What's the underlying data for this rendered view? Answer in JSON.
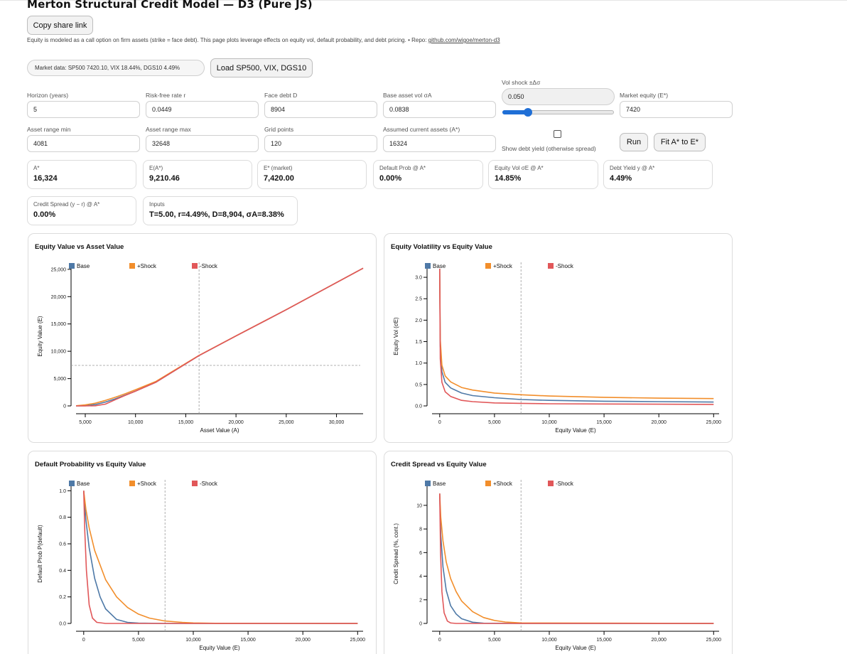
{
  "header": {
    "title": "Merton Structural Credit Model — D3 (Pure JS)",
    "copy_button": "Copy share link",
    "description_prefix": "Equity is modeled as a call option on firm assets (strike = face debt). This page plots leverage effects on equity vol, default probability, and debt pricing.  •  Repo: ",
    "repo_link": "github.com/wigoe/merton-d3"
  },
  "market": {
    "pill": "Market data: SP500 7420.10, VIX 18.44%, DGS10 4.49%",
    "load_button": "Load SP500, VIX, DGS10"
  },
  "inputs": {
    "horizon": {
      "label": "Horizon (years)",
      "value": "5"
    },
    "rate": {
      "label": "Risk-free rate r",
      "value": "0.0449"
    },
    "face_debt": {
      "label": "Face debt D",
      "value": "8904"
    },
    "base_vol": {
      "label": "Base asset vol σA",
      "value": "0.0838"
    },
    "vol_shock": {
      "label": "Vol shock ±Δσ",
      "value": "0.050",
      "slider_fraction": 0.2
    },
    "market_equity": {
      "label": "Market equity (E*)",
      "value": "7420"
    },
    "asset_min": {
      "label": "Asset range min",
      "value": "4081"
    },
    "asset_max": {
      "label": "Asset range max",
      "value": "32648"
    },
    "grid_points": {
      "label": "Grid points",
      "value": "120"
    },
    "current_assets": {
      "label": "Assumed current assets (A*)",
      "value": "16324"
    },
    "show_yield": {
      "label": "Show debt yield (otherwise spread)",
      "checked": false
    },
    "run_button": "Run",
    "fit_button": "Fit A* to E*"
  },
  "results": [
    {
      "label": "A*",
      "value": "16,324"
    },
    {
      "label": "E(A*)",
      "value": "9,210.46"
    },
    {
      "label": "E* (market)",
      "value": "7,420.00"
    },
    {
      "label": "Default Prob @ A*",
      "value": "0.00%"
    },
    {
      "label": "Equity Vol σE @ A*",
      "value": "14.85%"
    },
    {
      "label": "Debt Yield y @ A*",
      "value": "4.49%"
    },
    {
      "label": "Credit Spread (y − r) @ A*",
      "value": "0.00%"
    },
    {
      "label": "Inputs",
      "value": "T=5.00, r=4.49%, D=8,904, σA=8.38%"
    }
  ],
  "colors": {
    "base": "#4e79a7",
    "plus": "#f28e2b",
    "minus": "#e15759"
  },
  "legend": {
    "base": "Base",
    "plus": "+Shock",
    "minus": "-Shock"
  },
  "charts": [
    {
      "title": "Equity Value vs Asset Value",
      "chart_data": {
        "type": "line",
        "title": "Equity Value vs Asset Value",
        "xlabel": "Asset Value (A)",
        "ylabel": "Equity Value (E)",
        "xlim": [
          4081,
          32648
        ],
        "ylim": [
          0,
          25500
        ],
        "xticks": [
          5000,
          10000,
          15000,
          20000,
          25000,
          30000
        ],
        "yticks": [
          0,
          5000,
          10000,
          15000,
          20000,
          25000
        ],
        "x_tick_labels": [
          "5,000",
          "10,000",
          "15,000",
          "20,000",
          "25,000",
          "30,000"
        ],
        "y_tick_labels": [
          "0",
          "5,000",
          "10,000",
          "15,000",
          "20,000",
          "25,000"
        ],
        "vline_x": 16324,
        "hline_y": 7420,
        "grid": false,
        "legend_position": "top",
        "series": [
          {
            "name": "Base",
            "x": [
              4081,
              5000,
              6000,
              7000,
              8000,
              9000,
              10000,
              12000,
              16324,
              20000,
              25000,
              32648
            ],
            "y": [
              0,
              30,
              250,
              700,
              1300,
              2000,
              2700,
              4300,
              9210,
              12800,
              17600,
              25200
            ]
          },
          {
            "name": "+Shock",
            "x": [
              4081,
              5000,
              6000,
              7000,
              8000,
              9000,
              10000,
              12000,
              16324,
              20000,
              25000,
              32648
            ],
            "y": [
              30,
              180,
              500,
              1000,
              1600,
              2250,
              2950,
              4450,
              9250,
              12820,
              17620,
              25200
            ]
          },
          {
            "name": "-Shock",
            "x": [
              4081,
              5000,
              6000,
              7000,
              8000,
              9000,
              10000,
              12000,
              16324,
              20000,
              25000,
              32648
            ],
            "y": [
              0,
              0,
              30,
              330,
              1150,
              1950,
              2700,
              4300,
              9210,
              12800,
              17600,
              25200
            ]
          }
        ]
      }
    },
    {
      "title": "Equity Volatility vs Equity Value",
      "chart_data": {
        "type": "line",
        "title": "Equity Volatility vs Equity Value",
        "xlabel": "Equity Value (E)",
        "ylabel": "Equity Vol (σE)",
        "xlim": [
          -700,
          25500
        ],
        "ylim": [
          0,
          3.25
        ],
        "xticks": [
          0,
          5000,
          10000,
          15000,
          20000,
          25000
        ],
        "yticks": [
          0,
          0.5,
          1.0,
          1.5,
          2.0,
          2.5,
          3.0
        ],
        "x_tick_labels": [
          "0",
          "5,000",
          "10,000",
          "15,000",
          "20,000",
          "25,000"
        ],
        "y_tick_labels": [
          "0.0",
          "0.5",
          "1.0",
          "1.5",
          "2.0",
          "2.5",
          "3.0"
        ],
        "vline_x": 7420,
        "grid": false,
        "legend_position": "top",
        "series": [
          {
            "name": "Base",
            "x": [
              3,
              50,
              200,
              500,
              1000,
              2000,
              3000,
              5000,
              7420,
              10000,
              15000,
              20000,
              25000
            ],
            "y": [
              3.2,
              1.4,
              0.8,
              0.55,
              0.42,
              0.3,
              0.24,
              0.19,
              0.15,
              0.13,
              0.11,
              0.1,
              0.09
            ]
          },
          {
            "name": "+Shock",
            "x": [
              3,
              50,
              200,
              500,
              1000,
              2000,
              3000,
              5000,
              7420,
              10000,
              15000,
              20000,
              25000
            ],
            "y": [
              3.2,
              1.55,
              0.95,
              0.7,
              0.56,
              0.43,
              0.37,
              0.3,
              0.26,
              0.23,
              0.2,
              0.18,
              0.17
            ]
          },
          {
            "name": "-Shock",
            "x": [
              3,
              50,
              200,
              500,
              1000,
              2000,
              3000,
              5000,
              7420,
              10000,
              15000,
              20000,
              25000
            ],
            "y": [
              3.2,
              1.1,
              0.55,
              0.33,
              0.22,
              0.13,
              0.1,
              0.07,
              0.06,
              0.05,
              0.045,
              0.04,
              0.035
            ]
          }
        ]
      }
    },
    {
      "title": "Default Probability vs Equity Value",
      "chart_data": {
        "type": "line",
        "title": "Default Probability vs Equity Value",
        "xlabel": "Equity Value (E)",
        "ylabel": "Default Prob P(default)",
        "xlim": [
          -700,
          25500
        ],
        "ylim": [
          0,
          1.05
        ],
        "xticks": [
          0,
          5000,
          10000,
          15000,
          20000,
          25000
        ],
        "yticks": [
          0,
          0.2,
          0.4,
          0.6,
          0.8,
          1.0
        ],
        "x_tick_labels": [
          "0",
          "5,000",
          "10,000",
          "15,000",
          "20,000",
          "25,000"
        ],
        "y_tick_labels": [
          "0.0",
          "0.2",
          "0.4",
          "0.6",
          "0.8",
          "1.0"
        ],
        "vline_x": 7420,
        "grid": false,
        "legend_position": "top",
        "series": [
          {
            "name": "Base",
            "x": [
              0,
              200,
              500,
              1000,
              1500,
              2000,
              3000,
              4000,
              5000,
              7420,
              10000,
              25000
            ],
            "y": [
              1.0,
              0.78,
              0.57,
              0.34,
              0.2,
              0.11,
              0.03,
              0.008,
              0.002,
              0,
              0,
              0
            ]
          },
          {
            "name": "+Shock",
            "x": [
              0,
              200,
              500,
              1000,
              2000,
              3000,
              4000,
              5000,
              6000,
              7420,
              9000,
              10000,
              12000,
              25000
            ],
            "y": [
              1.0,
              0.86,
              0.72,
              0.55,
              0.33,
              0.2,
              0.12,
              0.07,
              0.04,
              0.018,
              0.008,
              0.004,
              0.001,
              0
            ]
          },
          {
            "name": "-Shock",
            "x": [
              0,
              100,
              250,
              500,
              800,
              1200,
              2000,
              7420,
              25000
            ],
            "y": [
              1.0,
              0.7,
              0.4,
              0.14,
              0.04,
              0.008,
              0,
              0,
              0
            ]
          }
        ]
      }
    },
    {
      "title": "Credit Spread vs Equity Value",
      "chart_data": {
        "type": "line",
        "title": "Credit Spread vs Equity Value",
        "xlabel": "Equity Value (E)",
        "ylabel": "Credit Spread (%, cont.)",
        "xlim": [
          -700,
          25500
        ],
        "ylim": [
          0,
          11.8
        ],
        "xticks": [
          0,
          5000,
          10000,
          15000,
          20000,
          25000
        ],
        "yticks": [
          0,
          2,
          4,
          6,
          8,
          10
        ],
        "x_tick_labels": [
          "0",
          "5,000",
          "10,000",
          "15,000",
          "20,000",
          "25,000"
        ],
        "y_tick_labels": [
          "0",
          "2",
          "4",
          "6",
          "8",
          "10"
        ],
        "vline_x": 7420,
        "grid": false,
        "legend_position": "top",
        "series": [
          {
            "name": "Base",
            "x": [
              0,
              100,
              300,
              600,
              1000,
              1500,
              2000,
              3000,
              4000,
              7420,
              25000
            ],
            "y": [
              11.0,
              7.5,
              4.8,
              2.8,
              1.5,
              0.8,
              0.4,
              0.1,
              0.02,
              0,
              0
            ]
          },
          {
            "name": "+Shock",
            "x": [
              0,
              100,
              300,
              600,
              1000,
              1500,
              2000,
              3000,
              4000,
              5000,
              6000,
              7420,
              25000
            ],
            "y": [
              11.0,
              9.0,
              7.0,
              5.2,
              3.8,
              2.7,
              1.9,
              1.0,
              0.5,
              0.25,
              0.12,
              0.04,
              0
            ]
          },
          {
            "name": "-Shock",
            "x": [
              0,
              80,
              200,
              400,
              700,
              1000,
              1500,
              7420,
              25000
            ],
            "y": [
              11.0,
              6.0,
              2.7,
              0.9,
              0.2,
              0.04,
              0,
              0,
              0
            ]
          }
        ]
      }
    }
  ]
}
